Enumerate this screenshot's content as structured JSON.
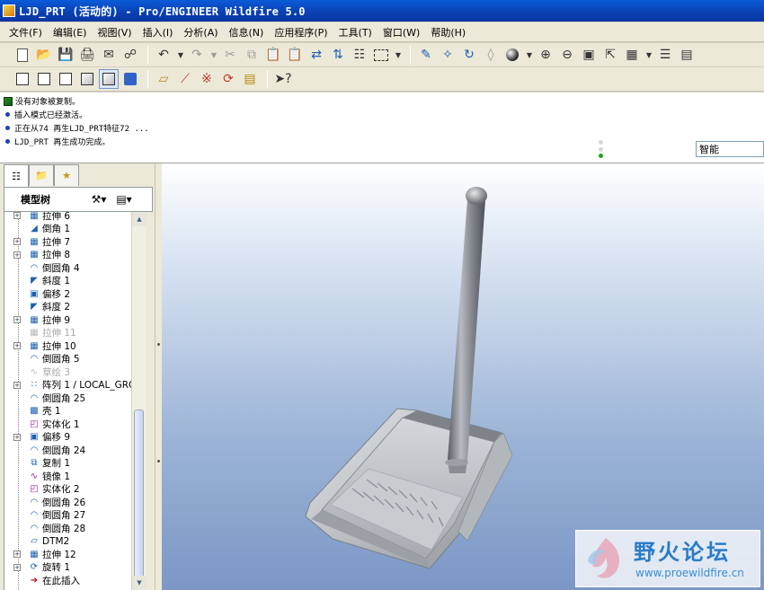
{
  "window": {
    "title": "LJD_PRT (活动的) - Pro/ENGINEER Wildfire 5.0"
  },
  "menu": [
    "文件(F)",
    "编辑(E)",
    "视图(V)",
    "插入(I)",
    "分析(A)",
    "信息(N)",
    "应用程序(P)",
    "工具(T)",
    "窗口(W)",
    "帮助(H)"
  ],
  "messages": [
    "没有对象被复制。",
    "插入模式已经激活。",
    "正在从74 再生LJD_PRT特征72 ...",
    "LJD_PRT 再生成功完成。"
  ],
  "filter": {
    "value": "智能"
  },
  "model_tree": {
    "title": "模型树",
    "items": [
      {
        "label": "拉伸 6",
        "icon": "extrude-icon",
        "expand": true,
        "dim": false
      },
      {
        "label": "倒角 1",
        "icon": "chamfer-icon",
        "expand": false,
        "dim": false
      },
      {
        "label": "拉伸 7",
        "icon": "extrude-icon",
        "expand": true,
        "dim": false
      },
      {
        "label": "拉伸 8",
        "icon": "extrude-icon",
        "expand": true,
        "dim": false
      },
      {
        "label": "倒圆角 4",
        "icon": "round-icon",
        "expand": false,
        "dim": false
      },
      {
        "label": "斜度 1",
        "icon": "draft-icon",
        "expand": false,
        "dim": false
      },
      {
        "label": "偏移 2",
        "icon": "offset-icon",
        "expand": false,
        "dim": false
      },
      {
        "label": "斜度 2",
        "icon": "draft-icon",
        "expand": false,
        "dim": false
      },
      {
        "label": "拉伸 9",
        "icon": "extrude-icon",
        "expand": true,
        "dim": false
      },
      {
        "label": "拉伸 11",
        "icon": "extrude-icon",
        "expand": false,
        "dim": true
      },
      {
        "label": "拉伸 10",
        "icon": "extrude-icon",
        "expand": true,
        "dim": false
      },
      {
        "label": "倒圆角 5",
        "icon": "round-icon",
        "expand": false,
        "dim": false
      },
      {
        "label": "草绘 3",
        "icon": "sketch-icon",
        "expand": false,
        "dim": true
      },
      {
        "label": "阵列 1 / LOCAL_GRO",
        "icon": "pattern-icon",
        "expand": true,
        "dim": false
      },
      {
        "label": "倒圆角 25",
        "icon": "round-icon",
        "expand": false,
        "dim": false
      },
      {
        "label": "壳 1",
        "icon": "shell-icon",
        "expand": false,
        "dim": false
      },
      {
        "label": "实体化 1",
        "icon": "solidify-icon",
        "expand": false,
        "dim": false
      },
      {
        "label": "偏移 9",
        "icon": "offset-icon",
        "expand": true,
        "dim": false
      },
      {
        "label": "倒圆角 24",
        "icon": "round-icon",
        "expand": false,
        "dim": false
      },
      {
        "label": "复制 1",
        "icon": "copy-icon",
        "expand": false,
        "dim": false
      },
      {
        "label": "镜像 1",
        "icon": "mirror-icon",
        "expand": false,
        "dim": false
      },
      {
        "label": "实体化 2",
        "icon": "solidify-icon",
        "expand": false,
        "dim": false
      },
      {
        "label": "倒圆角 26",
        "icon": "round-icon",
        "expand": false,
        "dim": false
      },
      {
        "label": "倒圆角 27",
        "icon": "round-icon",
        "expand": false,
        "dim": false
      },
      {
        "label": "倒圆角 28",
        "icon": "round-icon",
        "expand": false,
        "dim": false
      },
      {
        "label": "DTM2",
        "icon": "datum-plane-icon",
        "expand": false,
        "dim": false
      },
      {
        "label": "拉伸 12",
        "icon": "extrude-icon",
        "expand": true,
        "dim": false
      },
      {
        "label": "旋转 1",
        "icon": "revolve-icon",
        "expand": true,
        "dim": false
      },
      {
        "label": "在此插入",
        "icon": "insert-here-icon",
        "expand": false,
        "dim": false
      }
    ]
  },
  "watermark": {
    "text": "野火论坛",
    "url": "www.proewildfire.cn"
  },
  "colors": {
    "titlebar": "#0a4cc8",
    "viewport_top": "#ffffff",
    "viewport_bottom": "#7b97c6",
    "model_gray": "#9a9a9a",
    "accent_blue": "#2a7cc7"
  }
}
